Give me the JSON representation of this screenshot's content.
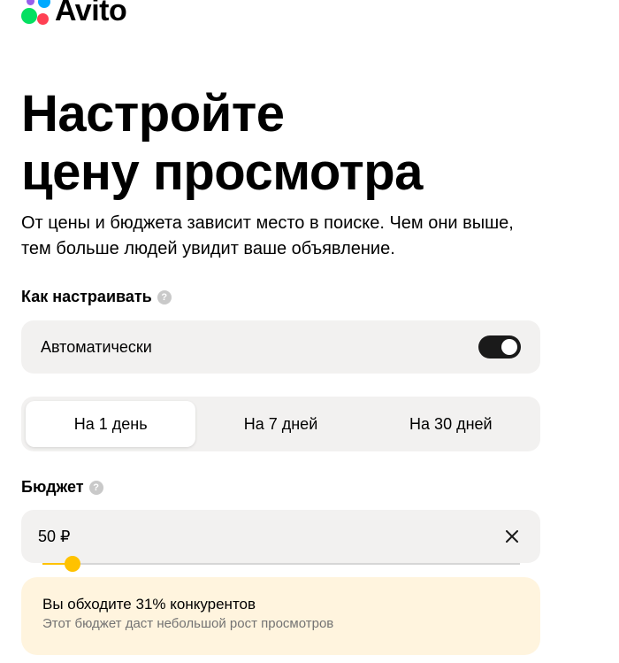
{
  "brand": {
    "name": "Avito"
  },
  "page": {
    "title_line1": "Настройте",
    "title_line2": "цену просмотра",
    "subtitle": "От цены и бюджета зависит место в поиске. Чем они выше, тем больше людей увидит ваше объявление."
  },
  "setup": {
    "label": "Как настраивать",
    "help": "?",
    "auto_label": "Автоматически",
    "auto_enabled": true
  },
  "period": {
    "options": [
      "На 1 день",
      "На 7 дней",
      "На 30 дней"
    ],
    "selected": "На 1 день"
  },
  "budget": {
    "label": "Бюджет",
    "help": "?",
    "value": "50 ₽",
    "slider_level": 0.03
  },
  "info": {
    "title": "Вы обходите 31% конкурентов",
    "subtitle": "Этот бюджет даст небольшой рост просмотров"
  },
  "colors": {
    "accent": "#ffc200",
    "toggle_on": "#1a1a1a",
    "card_bg": "#f2f1f0",
    "info_bg": "#fff4de"
  },
  "icons": {
    "help": "question-circle-icon",
    "clear": "close-icon",
    "logo": "avito-logo-dots"
  }
}
